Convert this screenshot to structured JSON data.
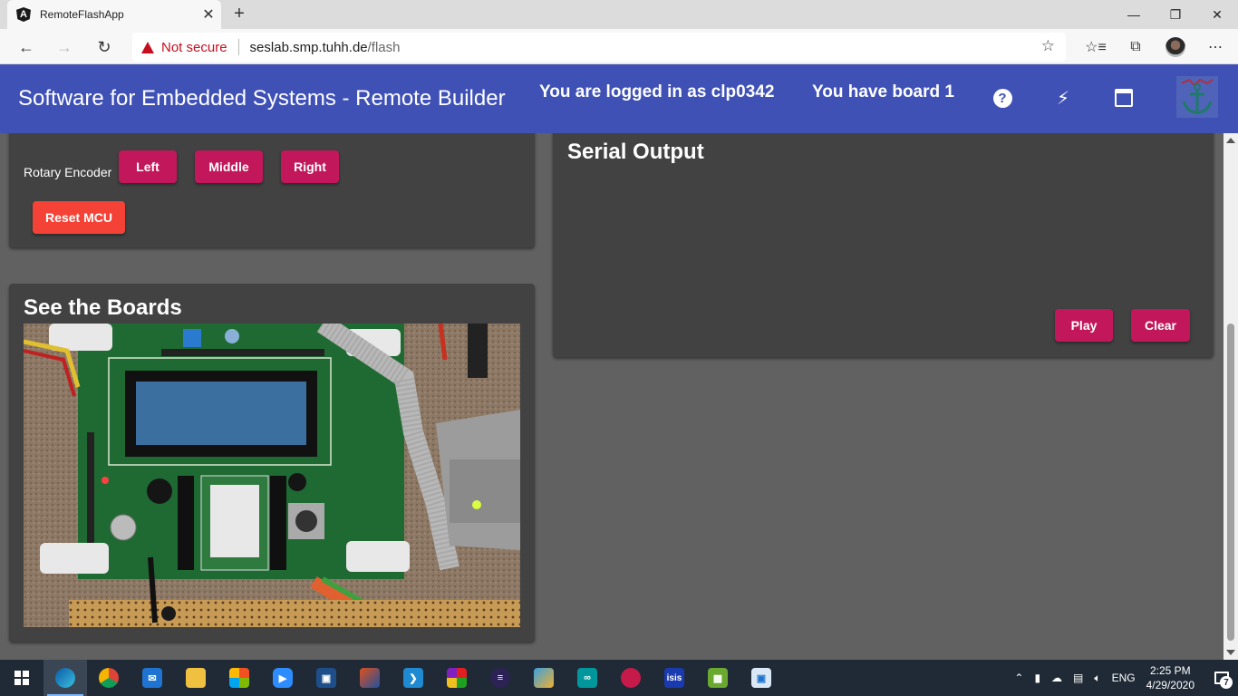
{
  "browser": {
    "tab_title": "RemoteFlashApp",
    "tab_favicon": "A",
    "security_text": "Not secure",
    "url_host": "seslab.smp.tuhh.de",
    "url_path": "/flash",
    "window_controls": [
      "minimize-icon",
      "restore-icon",
      "close-icon"
    ]
  },
  "header": {
    "title": "Software for Embedded Systems - Remote Builder",
    "login_status": "You are logged in as clp0342",
    "board_status": "You have board 1",
    "help_glyph": "?",
    "icons": [
      "help-icon",
      "flash-icon",
      "calendar-icon",
      "anchor-logo"
    ]
  },
  "rotary": {
    "label": "Rotary Encoder",
    "left": "Left",
    "middle": "Middle",
    "right": "Right",
    "reset": "Reset MCU"
  },
  "boards": {
    "title": "See the Boards"
  },
  "serial": {
    "title": "Serial Output",
    "play": "Play",
    "clear": "Clear"
  },
  "taskbar": {
    "apps": [
      "edge",
      "chrome",
      "mail",
      "file-explorer",
      "store",
      "zoom",
      "virtualbox",
      "matlab",
      "vscode",
      "app-tiles",
      "eclipse",
      "cube-app",
      "arduino",
      "raspberry-pi",
      "isis",
      "chart-app",
      "image-viewer"
    ],
    "language": "ENG",
    "time": "2:25 PM",
    "date": "4/29/2020",
    "notification_count": "7"
  },
  "colors": {
    "header": "#3f51b5",
    "accent_button": "#c2185b",
    "reset_button": "#f44336",
    "card": "#424242",
    "background": "#616161"
  }
}
